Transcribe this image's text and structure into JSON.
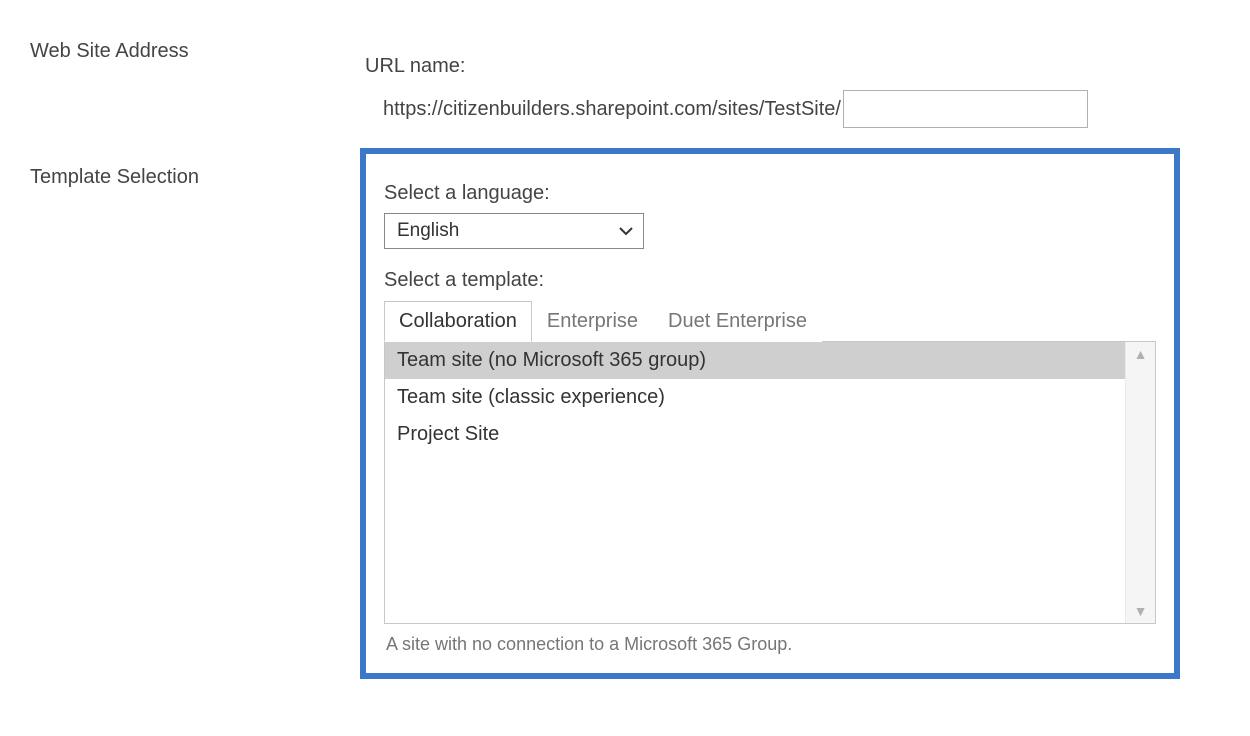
{
  "sections": {
    "web_site_address": {
      "label": "Web Site Address",
      "url_name_label": "URL name:",
      "url_prefix": "https://citizenbuilders.sharepoint.com/sites/TestSite/",
      "url_value": ""
    },
    "template_selection": {
      "label": "Template Selection",
      "language_label": "Select a language:",
      "language_value": "English",
      "template_label": "Select a template:",
      "tabs": [
        {
          "label": "Collaboration",
          "active": true
        },
        {
          "label": "Enterprise",
          "active": false
        },
        {
          "label": "Duet Enterprise",
          "active": false
        }
      ],
      "templates": [
        {
          "label": "Team site (no Microsoft 365 group)",
          "selected": true
        },
        {
          "label": "Team site (classic experience)",
          "selected": false
        },
        {
          "label": "Project Site",
          "selected": false
        }
      ],
      "description": "A site with no connection to a Microsoft 365 Group."
    }
  }
}
